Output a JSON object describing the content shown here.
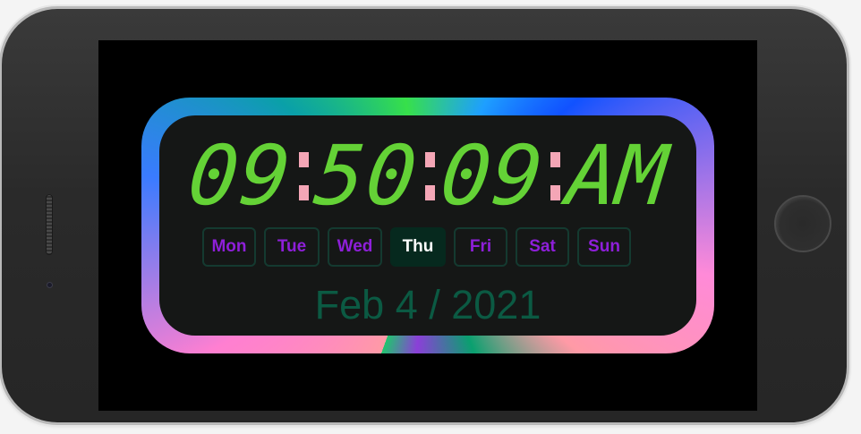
{
  "clock": {
    "hours": "09",
    "minutes": "50",
    "seconds": "09",
    "ampm": "AM"
  },
  "days": [
    {
      "label": "Mon",
      "active": false
    },
    {
      "label": "Tue",
      "active": false
    },
    {
      "label": "Wed",
      "active": false
    },
    {
      "label": "Thu",
      "active": true
    },
    {
      "label": "Fri",
      "active": false
    },
    {
      "label": "Sat",
      "active": false
    },
    {
      "label": "Sun",
      "active": false
    }
  ],
  "date": "Feb 4 / 2021",
  "colors": {
    "digits": "#64d236",
    "colon": "#f4a6b6",
    "day_text": "#8e1fd9",
    "day_active_bg": "#06291e",
    "date_text": "#0b5a43",
    "panel_bg": "#151716"
  }
}
